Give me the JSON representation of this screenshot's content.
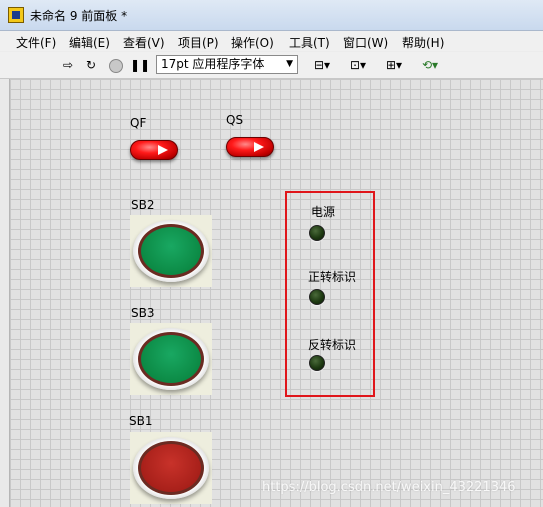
{
  "window": {
    "title": "未命名 9 前面板 *"
  },
  "menu": [
    "文件(F)",
    "编辑(E)",
    "查看(V)",
    "项目(P)",
    "操作(O)",
    "工具(T)",
    "窗口(W)",
    "帮助(H)"
  ],
  "toolbar": {
    "font_select": "17pt 应用程序字体",
    "run_icon": "run-arrow-icon",
    "run_continuous_icon": "run-continuously-icon",
    "abort_icon": "abort-icon",
    "pause_icon": "pause-icon",
    "align_icon": "align-objects-icon",
    "distribute_icon": "distribute-objects-icon",
    "resize_icon": "resize-objects-icon",
    "reorder_icon": "reorder-icon"
  },
  "panel": {
    "qf_label": "QF",
    "qs_label": "QS",
    "sb2_label": "SB2",
    "sb3_label": "SB3",
    "sb1_label": "SB1",
    "power_label": "电源",
    "forward_label": "正转标识",
    "reverse_label": "反转标识",
    "colors": {
      "green_button": "#0c8a45",
      "red_button": "#a8201a",
      "led_off": "#1e3a12",
      "highlight_box": "#e0161b"
    }
  },
  "watermark": "https://blog.csdn.net/weixin_43221346"
}
